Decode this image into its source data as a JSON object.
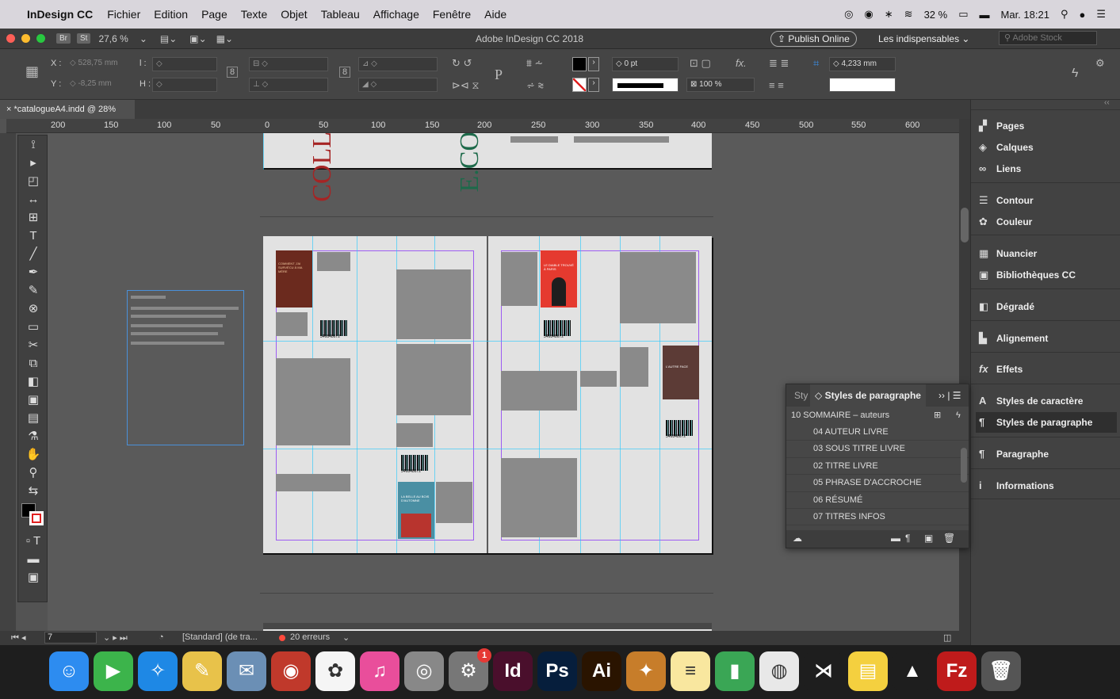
{
  "menubar": {
    "app": "InDesign CC",
    "items": [
      "Fichier",
      "Edition",
      "Page",
      "Texte",
      "Objet",
      "Tableau",
      "Affichage",
      "Fenêtre",
      "Aide"
    ],
    "battery": "32 %",
    "time": "Mar. 18:21"
  },
  "appbar": {
    "bridge": "Br",
    "stock_chip": "St",
    "zoom": "27,6 %",
    "title": "Adobe InDesign CC 2018",
    "publish": "Publish Online",
    "workspace": "Les indispensables",
    "search_placeholder": "Adobe Stock"
  },
  "control": {
    "x_label": "X :",
    "x_value": "528,75 mm",
    "y_label": "Y :",
    "y_value": "-8,25 mm",
    "w_label": "l :",
    "h_label": "H :",
    "stroke_weight": "0 pt",
    "scale": "100 %",
    "gutter": "4,233 mm",
    "ref_letter": "P",
    "fx": "fx."
  },
  "document": {
    "tab": "*catalogueA4.indd @ 28%"
  },
  "ruler": {
    "ticks": [
      "200",
      "150",
      "100",
      "50",
      "0",
      "50",
      "100",
      "150",
      "200",
      "250",
      "300",
      "350",
      "400",
      "450",
      "500",
      "550",
      "600"
    ]
  },
  "covers": {
    "c1_title": "COMMENT J'AI SURVÉCU À MA MÈRE",
    "c2_title": "LE DIABLE TROUVÉ À PARIS",
    "c3_title": "LA BELLE AU BOIS D'AUTOMNE",
    "c4_title": "L'AUTRE FACE",
    "barcode": "346848672",
    "spine1": "COLL",
    "spine2": "E.CO"
  },
  "styles_panel": {
    "tab_short": "Sty",
    "title": "Styles de paragraphe",
    "current": "10 SOMMAIRE – auteurs",
    "items": [
      "04 AUTEUR LIVRE",
      "03 SOUS TITRE LIVRE",
      "02 TITRE LIVRE",
      "05 PHRASE D'ACCROCHE",
      "06 RÉSUMÉ",
      "07 TITRES INFOS"
    ]
  },
  "side_panel": {
    "items": [
      {
        "label": "Pages",
        "icon": "pages-icon",
        "glyph": "▞"
      },
      {
        "label": "Calques",
        "icon": "layers-icon",
        "glyph": "◈"
      },
      {
        "label": "Liens",
        "icon": "links-icon",
        "glyph": "∞"
      },
      {
        "label": "Contour",
        "icon": "stroke-icon",
        "glyph": "☰"
      },
      {
        "label": "Couleur",
        "icon": "color-icon",
        "glyph": "✿"
      },
      {
        "label": "Nuancier",
        "icon": "swatches-icon",
        "glyph": "▦"
      },
      {
        "label": "Bibliothèques CC",
        "icon": "libraries-icon",
        "glyph": "▣"
      },
      {
        "label": "Dégradé",
        "icon": "gradient-icon",
        "glyph": "◧"
      },
      {
        "label": "Alignement",
        "icon": "align-icon",
        "glyph": "▙"
      },
      {
        "label": "Effets",
        "icon": "effects-icon",
        "glyph": "fx"
      },
      {
        "label": "Styles de caractère",
        "icon": "char-styles-icon",
        "glyph": "A"
      },
      {
        "label": "Styles de paragraphe",
        "icon": "para-styles-icon",
        "glyph": "¶"
      },
      {
        "label": "Paragraphe",
        "icon": "paragraph-icon",
        "glyph": "¶"
      },
      {
        "label": "Informations",
        "icon": "info-icon",
        "glyph": "i"
      }
    ]
  },
  "status": {
    "page": "7",
    "style": "[Standard] (de tra...",
    "errors": "20 erreurs"
  },
  "dock": {
    "badge": "1",
    "apps": [
      {
        "name": "finder",
        "label": "☺",
        "color": "#2d8cf0"
      },
      {
        "name": "facetime",
        "label": "▶",
        "color": "#3cb44b"
      },
      {
        "name": "safari",
        "label": "✧",
        "color": "#1e88e5"
      },
      {
        "name": "textedit",
        "label": "✎",
        "color": "#e8c24a"
      },
      {
        "name": "preview",
        "label": "✉",
        "color": "#6b8fb5"
      },
      {
        "name": "photobooth",
        "label": "◉",
        "color": "#c0392b"
      },
      {
        "name": "photos",
        "label": "✿",
        "color": "#f5f5f5"
      },
      {
        "name": "itunes",
        "label": "♫",
        "color": "#e94e9b"
      },
      {
        "name": "screenshot",
        "label": "◎",
        "color": "#888888"
      },
      {
        "name": "system-prefs",
        "label": "⚙",
        "color": "#777777"
      },
      {
        "name": "indesign",
        "label": "Id",
        "color": "#4a0f2c"
      },
      {
        "name": "photoshop",
        "label": "Ps",
        "color": "#061e3c"
      },
      {
        "name": "illustrator",
        "label": "Ai",
        "color": "#2a1400"
      },
      {
        "name": "flash",
        "label": "✦",
        "color": "#c77d2a"
      },
      {
        "name": "notes",
        "label": "≡",
        "color": "#f9e79f"
      },
      {
        "name": "numbers",
        "label": "▮",
        "color": "#3aa655"
      },
      {
        "name": "chrome",
        "label": "◍",
        "color": "#e8e8e8"
      },
      {
        "name": "vscode",
        "label": "⋊",
        "color": "#1e1e1e"
      },
      {
        "name": "stickies",
        "label": "▤",
        "color": "#f4d03f"
      },
      {
        "name": "vlc",
        "label": "▲",
        "color": "#1e1e1e"
      },
      {
        "name": "filezilla",
        "label": "Fz",
        "color": "#bf1b1b"
      },
      {
        "name": "trash",
        "label": "🗑",
        "color": "#555555"
      }
    ]
  },
  "colors": {
    "guide": "#1ec8ff",
    "margin": "#9d5cf2",
    "accent": "#ff5b4a"
  }
}
